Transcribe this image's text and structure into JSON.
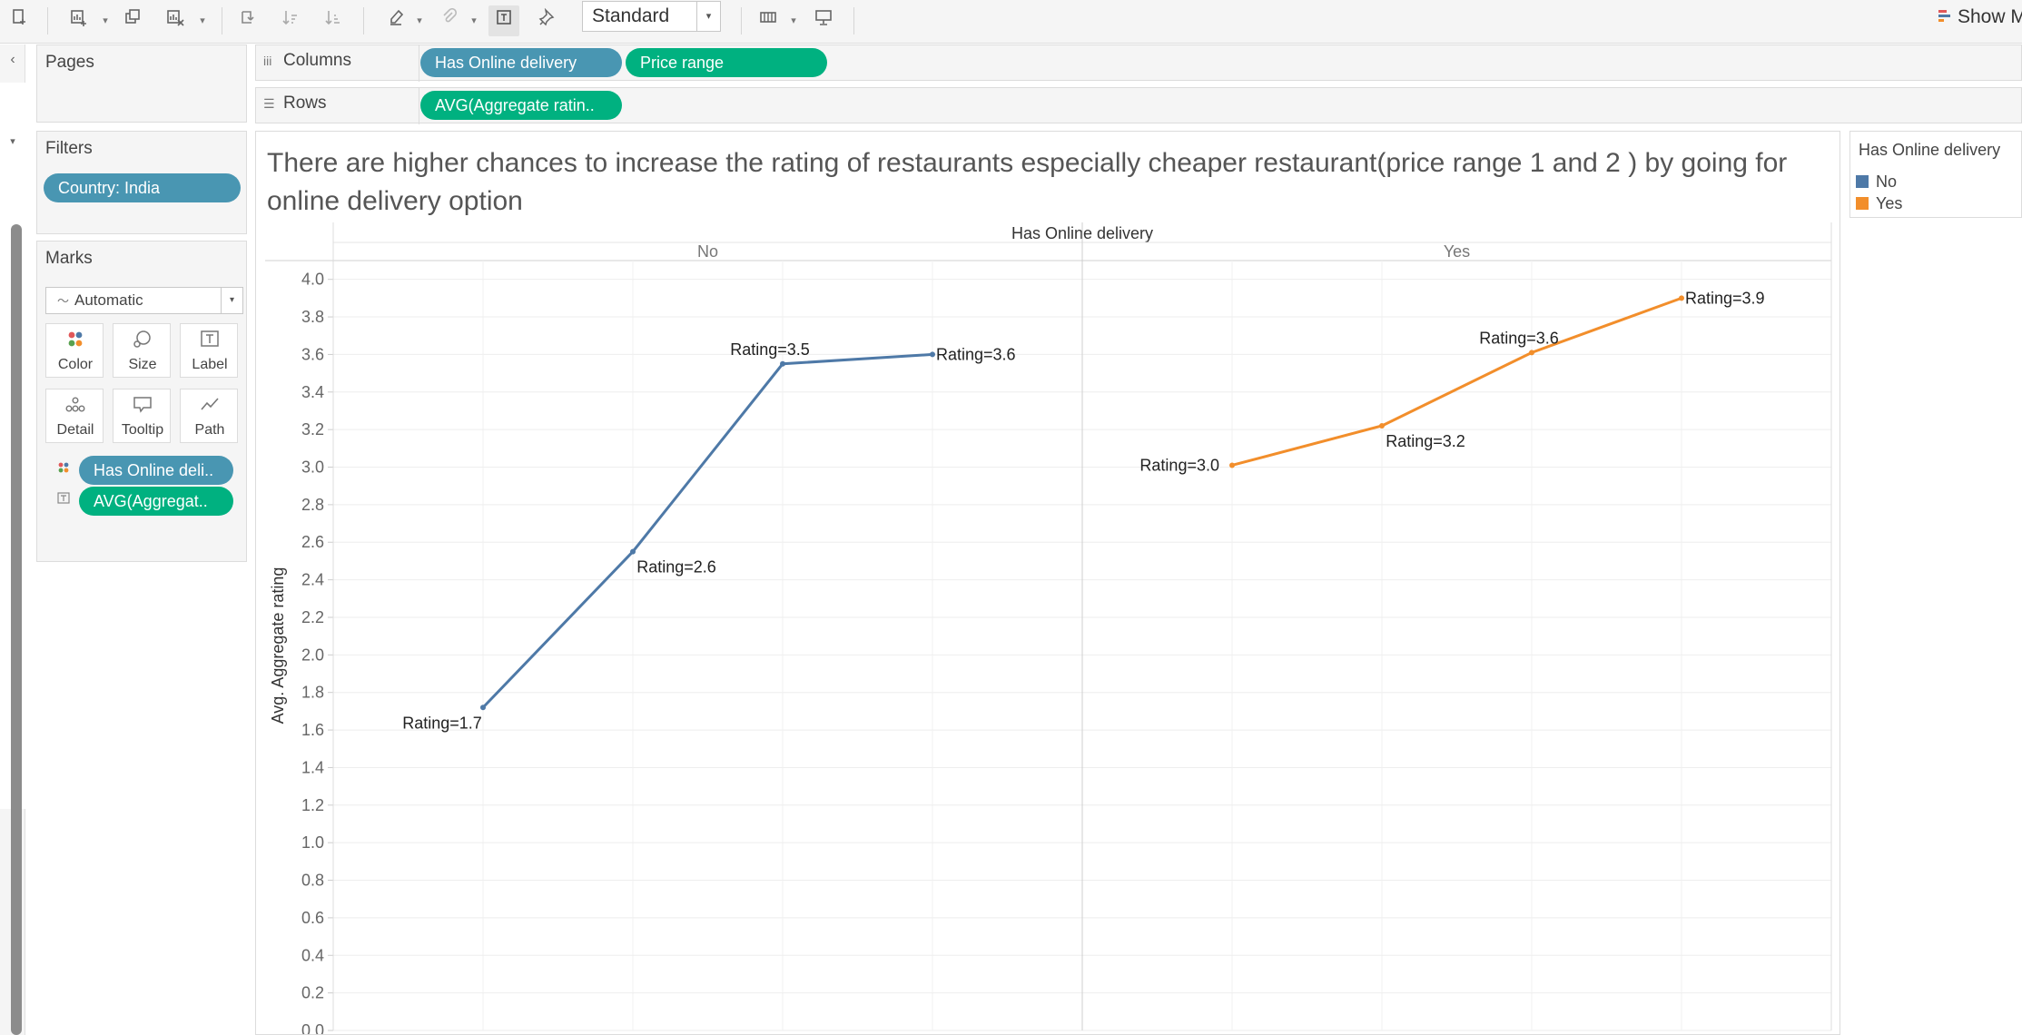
{
  "toolbar": {
    "fit_select": "Standard",
    "show_me": "Show M",
    "icons": [
      "new-worksheet-icon",
      "new-chart-icon",
      "duplicate-icon",
      "clear-sheet-icon",
      "swap-icon",
      "sort-ascending-icon",
      "sort-descending-icon",
      "highlight-icon",
      "group-icon",
      "show-labels-icon",
      "fix-axes-icon",
      "fit-icon",
      "presentation-icon"
    ]
  },
  "pages": {
    "title": "Pages"
  },
  "filters": {
    "title": "Filters",
    "pills": [
      "Country: India"
    ]
  },
  "marks": {
    "title": "Marks",
    "type": "Automatic",
    "cards": [
      "Color",
      "Size",
      "Label",
      "Detail",
      "Tooltip",
      "Path"
    ],
    "fields": [
      "Has Online deli..",
      "AVG(Aggregat.."
    ]
  },
  "shelves": {
    "columns_label": "Columns",
    "columns_pills": [
      "Has Online delivery",
      "Price range"
    ],
    "rows_label": "Rows",
    "rows_pills": [
      "AVG(Aggregate ratin.."
    ]
  },
  "view": {
    "title": "There are higher chances to increase the rating of restaurants especially cheaper restaurant(price range 1 and 2 ) by going for online delivery option"
  },
  "legend": {
    "title": "Has Online delivery",
    "items": [
      {
        "label": "No",
        "color": "#4e79a7"
      },
      {
        "label": "Yes",
        "color": "#f28e2b"
      }
    ]
  },
  "chart_data": {
    "type": "line",
    "header": "Has Online delivery",
    "panes": [
      "No",
      "Yes"
    ],
    "ylabel": "Avg. Aggregate rating",
    "ylim": [
      0,
      4.1
    ],
    "yticks": [
      "0.0",
      "0.2",
      "0.4",
      "0.6",
      "0.8",
      "1.0",
      "1.2",
      "1.4",
      "1.6",
      "1.8",
      "2.0",
      "2.2",
      "2.4",
      "2.6",
      "2.8",
      "3.0",
      "3.2",
      "3.4",
      "3.6",
      "3.8",
      "4.0"
    ],
    "xlim": [
      0,
      5
    ],
    "xticks": [
      "0",
      "1",
      "2",
      "3",
      "4",
      "5"
    ],
    "grid": true,
    "series": [
      {
        "name": "No",
        "color": "#4e79a7",
        "x": [
          1,
          2,
          3,
          4
        ],
        "y": [
          1.72,
          2.55,
          3.55,
          3.6
        ],
        "labels": [
          "Rating=1.7",
          "Rating=2.6",
          "Rating=3.5",
          "Rating=3.6"
        ],
        "label_pos": [
          "left-below",
          "right-below",
          "left-above",
          "right"
        ]
      },
      {
        "name": "Yes",
        "color": "#f28e2b",
        "x": [
          1,
          2,
          3,
          4
        ],
        "y": [
          3.01,
          3.22,
          3.61,
          3.9
        ],
        "labels": [
          "Rating=3.0",
          "Rating=3.2",
          "Rating=3.6",
          "Rating=3.9"
        ],
        "label_pos": [
          "left",
          "right-below",
          "left-above",
          "right"
        ]
      }
    ]
  }
}
